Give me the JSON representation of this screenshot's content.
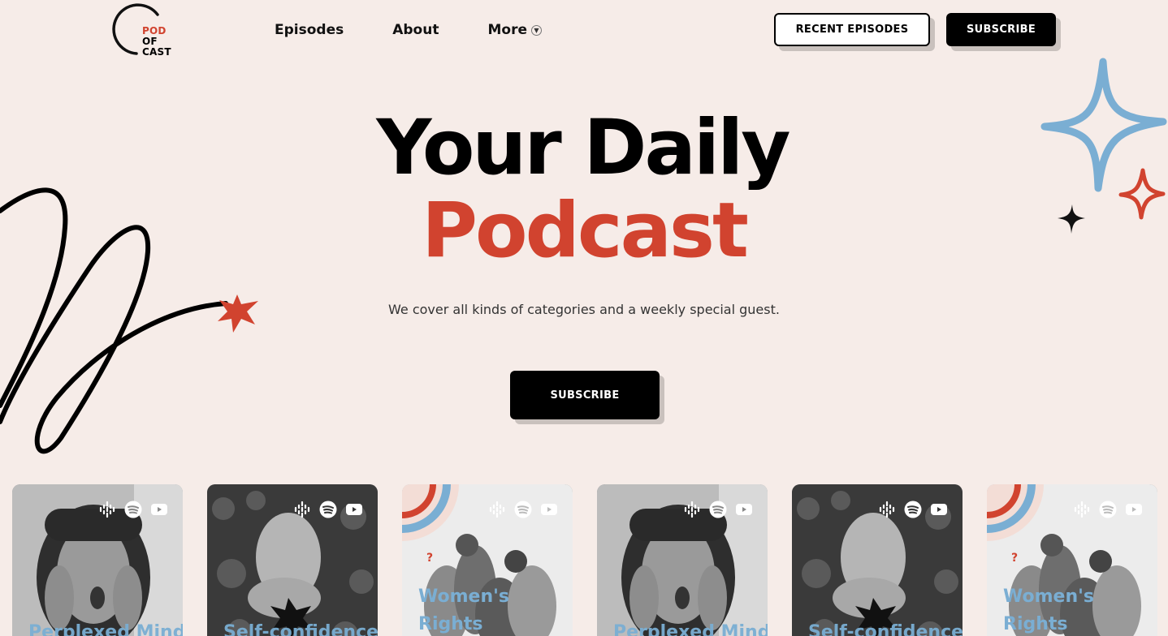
{
  "logo": {
    "line1": "POD",
    "line2": "OF",
    "line3": "CAST"
  },
  "nav": {
    "episodes": "Episodes",
    "about": "About",
    "more": "More"
  },
  "header_buttons": {
    "recent": "RECENT EPISODES",
    "subscribe": "SUBSCRIBE"
  },
  "hero": {
    "title_line1": "Your Daily",
    "title_line2": "Podcast",
    "tagline": "We cover all kinds of categories and a weekly special guest.",
    "cta": "SUBSCRIBE"
  },
  "colors": {
    "background": "#f6ece8",
    "accent_red": "#d1432f",
    "accent_blue": "#7aaed3",
    "black": "#000000"
  },
  "cards": [
    {
      "title": "Perplexed Mind",
      "icons": [
        "podcasts-icon",
        "spotify-icon",
        "youtube-icon"
      ]
    },
    {
      "title": "Self-confidence",
      "icons": [
        "podcasts-icon",
        "spotify-icon",
        "youtube-icon"
      ]
    },
    {
      "title_line1": "Women's",
      "title_line2": "Rights",
      "icons": [
        "podcasts-icon",
        "spotify-icon",
        "youtube-icon"
      ]
    },
    {
      "title": "Perplexed Mind",
      "icons": [
        "podcasts-icon",
        "spotify-icon",
        "youtube-icon"
      ]
    },
    {
      "title": "Self-confidence",
      "icons": [
        "podcasts-icon",
        "spotify-icon",
        "youtube-icon"
      ]
    },
    {
      "title_line1": "Women's",
      "title_line2": "Rights",
      "icons": [
        "podcasts-icon",
        "spotify-icon",
        "youtube-icon"
      ]
    }
  ]
}
